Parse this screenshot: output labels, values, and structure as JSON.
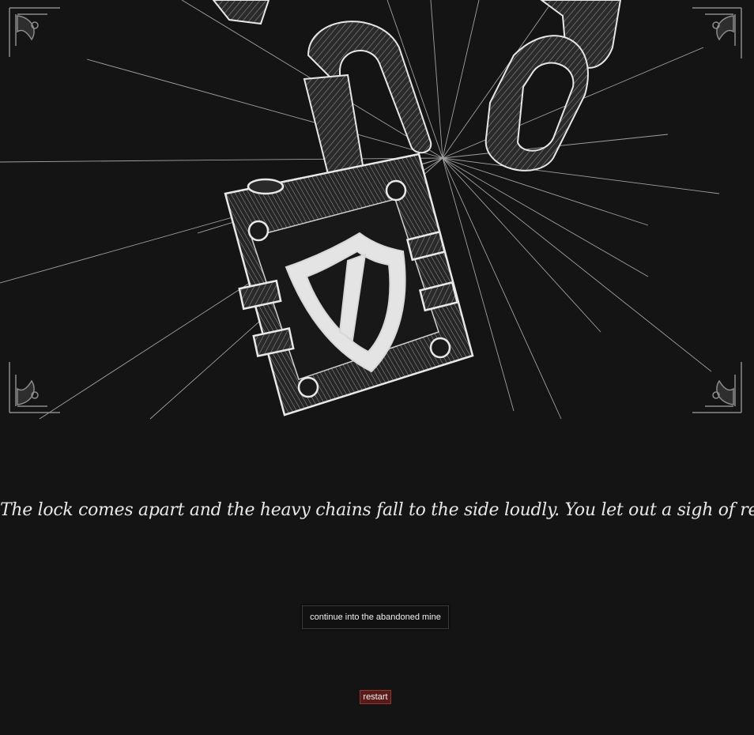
{
  "scene": {
    "image_subject": "broken-padlock-with-chains"
  },
  "narration": {
    "text": "The lock comes apart and the heavy chains fall to the side loudly. You let out a sigh of relief."
  },
  "choices": [
    {
      "label": "continue into the abandoned mine"
    }
  ],
  "controls": {
    "restart_label": "restart"
  },
  "colors": {
    "background": "#141414",
    "text": "#e8e8e8",
    "restart": "#5a1a18"
  }
}
